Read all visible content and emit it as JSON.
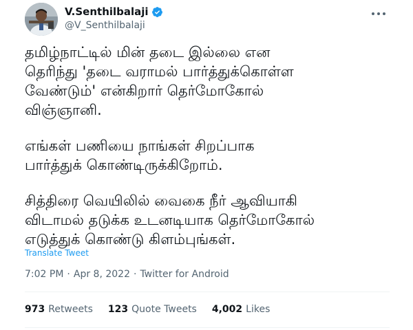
{
  "author": {
    "display_name": "V.Senthilbalaji",
    "handle": "@V_Senthilbalaji",
    "verified": true,
    "verified_color": "#1d9bf0"
  },
  "tweet": {
    "paragraphs": [
      "தமிழ்நாட்டில் மின் தடை இல்லை என\nதெரிந்து 'தடை வராமல் பார்த்துக்கொள்ள\nவேண்டும்' என்கிறார் தெர்மோகோல்\nவிஞ்ஞானி.",
      "எங்கள் பணியை நாங்கள் சிறப்பாக\nபார்த்துக் கொண்டிருக்கிறோம்.",
      "சித்திரை வெயிலில் வைகை நீர் ஆவியாகி\nவிடாமல் தடுக்க உடனடியாக தெர்மோகோல்\nஎடுத்துக் கொண்டு கிளம்புங்கள்."
    ],
    "translate_label": "Translate Tweet"
  },
  "meta": {
    "time": "7:02 PM",
    "separator": "·",
    "date": "Apr 8, 2022",
    "source": "Twitter for Android"
  },
  "stats": {
    "retweets_count": "973",
    "retweets_label": "Retweets",
    "quote_tweets_count": "123",
    "quote_tweets_label": "Quote Tweets",
    "likes_count": "4,002",
    "likes_label": "Likes"
  },
  "colors": {
    "accent": "#1d9bf0",
    "text_primary": "#0f1419",
    "text_secondary": "#536471",
    "divider": "#eff3f4"
  },
  "icons": {
    "verified": "verified-badge-icon",
    "more": "more-options-icon"
  }
}
